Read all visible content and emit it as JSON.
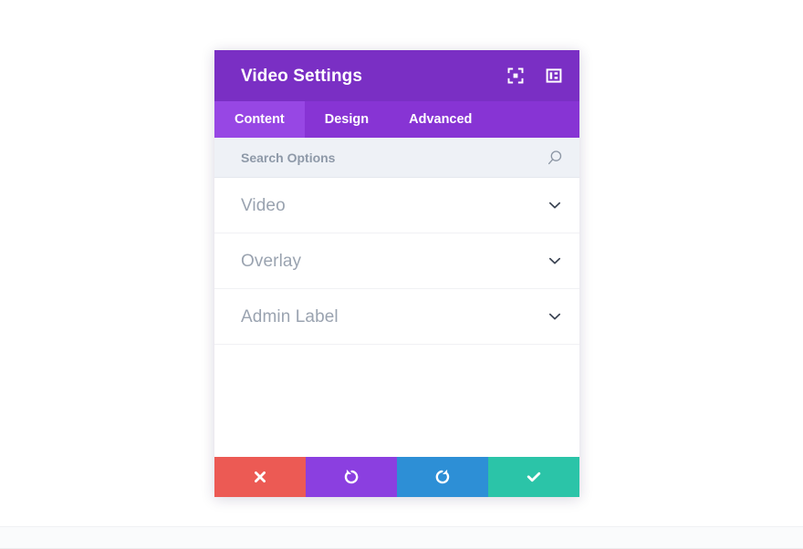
{
  "modal": {
    "title": "Video Settings",
    "header_icons": [
      {
        "name": "expand-fullscreen-icon",
        "label": "Expand view"
      },
      {
        "name": "panel-layout-icon",
        "label": "Change layout"
      }
    ],
    "tabs": [
      {
        "label": "Content",
        "active": true
      },
      {
        "label": "Design",
        "active": false
      },
      {
        "label": "Advanced",
        "active": false
      }
    ],
    "search": {
      "placeholder": "Search Options",
      "value": "",
      "icon": "search-icon"
    },
    "sections": [
      {
        "label": "Video",
        "expanded": false,
        "icon": "chevron-down-icon"
      },
      {
        "label": "Overlay",
        "expanded": false,
        "icon": "chevron-down-icon"
      },
      {
        "label": "Admin Label",
        "expanded": false,
        "icon": "chevron-down-icon"
      }
    ],
    "footer_buttons": [
      {
        "name": "cancel-button",
        "icon": "close-x-icon",
        "label": "Cancel",
        "color": "#EC5A54"
      },
      {
        "name": "undo-button",
        "icon": "undo-arrow-icon",
        "label": "Undo",
        "color": "#8B3FE0"
      },
      {
        "name": "redo-button",
        "icon": "redo-arrow-icon",
        "label": "Redo",
        "color": "#2D8FD6"
      },
      {
        "name": "save-button",
        "icon": "checkmark-icon",
        "label": "Save",
        "color": "#2BC4A8"
      }
    ]
  },
  "colors": {
    "header_purple": "#7A2FC4",
    "tabbar_purple": "#8734D4",
    "tab_active_purple": "#9747E4",
    "search_bg": "#EEF1F6",
    "label_gray": "#9AA3B0",
    "page_bg": "#FFFFFF"
  }
}
